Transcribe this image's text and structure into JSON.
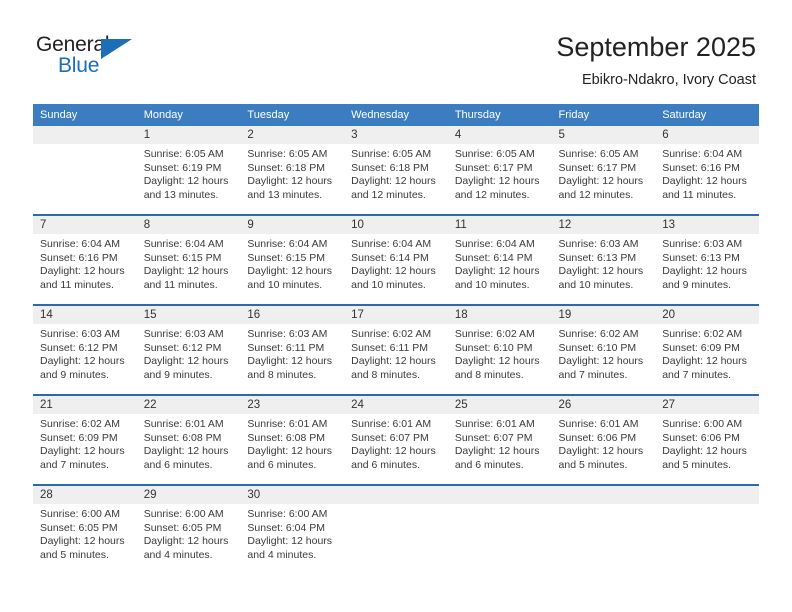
{
  "brand": {
    "name_part1": "General",
    "name_part2": "Blue"
  },
  "header": {
    "month_title": "September 2025",
    "location": "Ebikro-Ndakro, Ivory Coast"
  },
  "colors": {
    "header_blue": "#3b7dc0",
    "separator_blue": "#2a6aad",
    "daynum_band": "#efefef",
    "brand_blue": "#1c6fb5",
    "text": "#3a3a3a"
  },
  "weekday_headers": [
    "Sunday",
    "Monday",
    "Tuesday",
    "Wednesday",
    "Thursday",
    "Friday",
    "Saturday"
  ],
  "weeks": [
    [
      {
        "day": "",
        "sunrise": "",
        "sunset": "",
        "daylight_line1": "",
        "daylight_line2": ""
      },
      {
        "day": "1",
        "sunrise": "Sunrise: 6:05 AM",
        "sunset": "Sunset: 6:19 PM",
        "daylight_line1": "Daylight: 12 hours",
        "daylight_line2": "and 13 minutes."
      },
      {
        "day": "2",
        "sunrise": "Sunrise: 6:05 AM",
        "sunset": "Sunset: 6:18 PM",
        "daylight_line1": "Daylight: 12 hours",
        "daylight_line2": "and 13 minutes."
      },
      {
        "day": "3",
        "sunrise": "Sunrise: 6:05 AM",
        "sunset": "Sunset: 6:18 PM",
        "daylight_line1": "Daylight: 12 hours",
        "daylight_line2": "and 12 minutes."
      },
      {
        "day": "4",
        "sunrise": "Sunrise: 6:05 AM",
        "sunset": "Sunset: 6:17 PM",
        "daylight_line1": "Daylight: 12 hours",
        "daylight_line2": "and 12 minutes."
      },
      {
        "day": "5",
        "sunrise": "Sunrise: 6:05 AM",
        "sunset": "Sunset: 6:17 PM",
        "daylight_line1": "Daylight: 12 hours",
        "daylight_line2": "and 12 minutes."
      },
      {
        "day": "6",
        "sunrise": "Sunrise: 6:04 AM",
        "sunset": "Sunset: 6:16 PM",
        "daylight_line1": "Daylight: 12 hours",
        "daylight_line2": "and 11 minutes."
      }
    ],
    [
      {
        "day": "7",
        "sunrise": "Sunrise: 6:04 AM",
        "sunset": "Sunset: 6:16 PM",
        "daylight_line1": "Daylight: 12 hours",
        "daylight_line2": "and 11 minutes."
      },
      {
        "day": "8",
        "sunrise": "Sunrise: 6:04 AM",
        "sunset": "Sunset: 6:15 PM",
        "daylight_line1": "Daylight: 12 hours",
        "daylight_line2": "and 11 minutes."
      },
      {
        "day": "9",
        "sunrise": "Sunrise: 6:04 AM",
        "sunset": "Sunset: 6:15 PM",
        "daylight_line1": "Daylight: 12 hours",
        "daylight_line2": "and 10 minutes."
      },
      {
        "day": "10",
        "sunrise": "Sunrise: 6:04 AM",
        "sunset": "Sunset: 6:14 PM",
        "daylight_line1": "Daylight: 12 hours",
        "daylight_line2": "and 10 minutes."
      },
      {
        "day": "11",
        "sunrise": "Sunrise: 6:04 AM",
        "sunset": "Sunset: 6:14 PM",
        "daylight_line1": "Daylight: 12 hours",
        "daylight_line2": "and 10 minutes."
      },
      {
        "day": "12",
        "sunrise": "Sunrise: 6:03 AM",
        "sunset": "Sunset: 6:13 PM",
        "daylight_line1": "Daylight: 12 hours",
        "daylight_line2": "and 10 minutes."
      },
      {
        "day": "13",
        "sunrise": "Sunrise: 6:03 AM",
        "sunset": "Sunset: 6:13 PM",
        "daylight_line1": "Daylight: 12 hours",
        "daylight_line2": "and 9 minutes."
      }
    ],
    [
      {
        "day": "14",
        "sunrise": "Sunrise: 6:03 AM",
        "sunset": "Sunset: 6:12 PM",
        "daylight_line1": "Daylight: 12 hours",
        "daylight_line2": "and 9 minutes."
      },
      {
        "day": "15",
        "sunrise": "Sunrise: 6:03 AM",
        "sunset": "Sunset: 6:12 PM",
        "daylight_line1": "Daylight: 12 hours",
        "daylight_line2": "and 9 minutes."
      },
      {
        "day": "16",
        "sunrise": "Sunrise: 6:03 AM",
        "sunset": "Sunset: 6:11 PM",
        "daylight_line1": "Daylight: 12 hours",
        "daylight_line2": "and 8 minutes."
      },
      {
        "day": "17",
        "sunrise": "Sunrise: 6:02 AM",
        "sunset": "Sunset: 6:11 PM",
        "daylight_line1": "Daylight: 12 hours",
        "daylight_line2": "and 8 minutes."
      },
      {
        "day": "18",
        "sunrise": "Sunrise: 6:02 AM",
        "sunset": "Sunset: 6:10 PM",
        "daylight_line1": "Daylight: 12 hours",
        "daylight_line2": "and 8 minutes."
      },
      {
        "day": "19",
        "sunrise": "Sunrise: 6:02 AM",
        "sunset": "Sunset: 6:10 PM",
        "daylight_line1": "Daylight: 12 hours",
        "daylight_line2": "and 7 minutes."
      },
      {
        "day": "20",
        "sunrise": "Sunrise: 6:02 AM",
        "sunset": "Sunset: 6:09 PM",
        "daylight_line1": "Daylight: 12 hours",
        "daylight_line2": "and 7 minutes."
      }
    ],
    [
      {
        "day": "21",
        "sunrise": "Sunrise: 6:02 AM",
        "sunset": "Sunset: 6:09 PM",
        "daylight_line1": "Daylight: 12 hours",
        "daylight_line2": "and 7 minutes."
      },
      {
        "day": "22",
        "sunrise": "Sunrise: 6:01 AM",
        "sunset": "Sunset: 6:08 PM",
        "daylight_line1": "Daylight: 12 hours",
        "daylight_line2": "and 6 minutes."
      },
      {
        "day": "23",
        "sunrise": "Sunrise: 6:01 AM",
        "sunset": "Sunset: 6:08 PM",
        "daylight_line1": "Daylight: 12 hours",
        "daylight_line2": "and 6 minutes."
      },
      {
        "day": "24",
        "sunrise": "Sunrise: 6:01 AM",
        "sunset": "Sunset: 6:07 PM",
        "daylight_line1": "Daylight: 12 hours",
        "daylight_line2": "and 6 minutes."
      },
      {
        "day": "25",
        "sunrise": "Sunrise: 6:01 AM",
        "sunset": "Sunset: 6:07 PM",
        "daylight_line1": "Daylight: 12 hours",
        "daylight_line2": "and 6 minutes."
      },
      {
        "day": "26",
        "sunrise": "Sunrise: 6:01 AM",
        "sunset": "Sunset: 6:06 PM",
        "daylight_line1": "Daylight: 12 hours",
        "daylight_line2": "and 5 minutes."
      },
      {
        "day": "27",
        "sunrise": "Sunrise: 6:00 AM",
        "sunset": "Sunset: 6:06 PM",
        "daylight_line1": "Daylight: 12 hours",
        "daylight_line2": "and 5 minutes."
      }
    ],
    [
      {
        "day": "28",
        "sunrise": "Sunrise: 6:00 AM",
        "sunset": "Sunset: 6:05 PM",
        "daylight_line1": "Daylight: 12 hours",
        "daylight_line2": "and 5 minutes."
      },
      {
        "day": "29",
        "sunrise": "Sunrise: 6:00 AM",
        "sunset": "Sunset: 6:05 PM",
        "daylight_line1": "Daylight: 12 hours",
        "daylight_line2": "and 4 minutes."
      },
      {
        "day": "30",
        "sunrise": "Sunrise: 6:00 AM",
        "sunset": "Sunset: 6:04 PM",
        "daylight_line1": "Daylight: 12 hours",
        "daylight_line2": "and 4 minutes."
      },
      {
        "day": "",
        "sunrise": "",
        "sunset": "",
        "daylight_line1": "",
        "daylight_line2": ""
      },
      {
        "day": "",
        "sunrise": "",
        "sunset": "",
        "daylight_line1": "",
        "daylight_line2": ""
      },
      {
        "day": "",
        "sunrise": "",
        "sunset": "",
        "daylight_line1": "",
        "daylight_line2": ""
      },
      {
        "day": "",
        "sunrise": "",
        "sunset": "",
        "daylight_line1": "",
        "daylight_line2": ""
      }
    ]
  ]
}
